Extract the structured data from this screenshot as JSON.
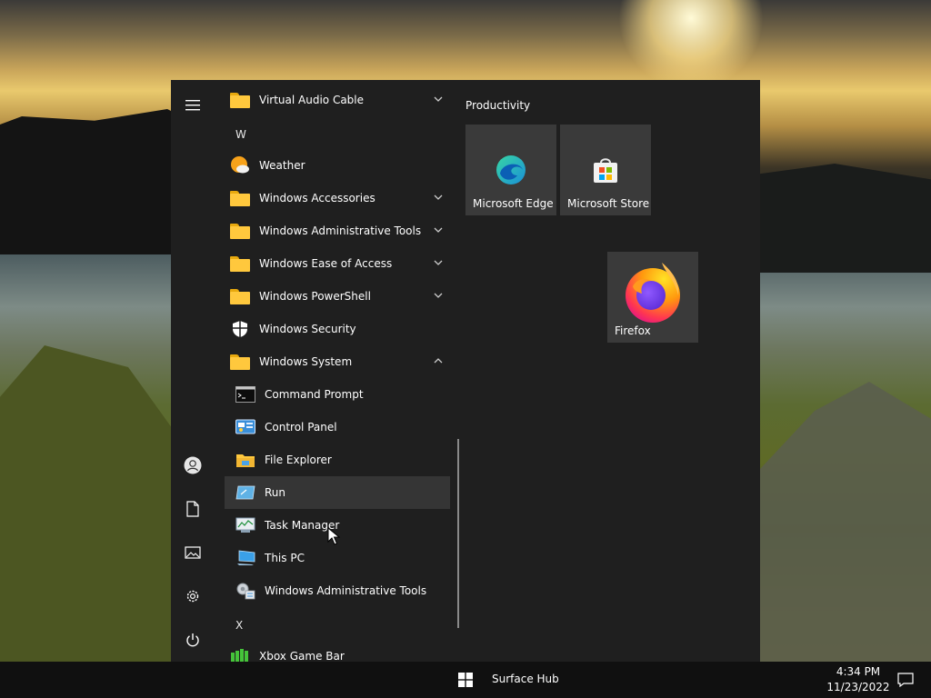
{
  "apps": {
    "virtual_audio_cable": "Virtual Audio Cable",
    "letter_w": "W",
    "weather": "Weather",
    "windows_accessories": "Windows Accessories",
    "windows_admin_tools": "Windows Administrative Tools",
    "windows_ease_of_access": "Windows Ease of Access",
    "windows_powershell": "Windows PowerShell",
    "windows_security": "Windows Security",
    "windows_system": "Windows System",
    "command_prompt": "Command Prompt",
    "control_panel": "Control Panel",
    "file_explorer": "File Explorer",
    "run": "Run",
    "task_manager": "Task Manager",
    "this_pc": "This PC",
    "windows_admin_tools_sub": "Windows Administrative Tools",
    "letter_x": "X",
    "xbox_game_bar": "Xbox Game Bar"
  },
  "tiles": {
    "group_title": "Productivity",
    "edge": "Microsoft Edge",
    "store": "Microsoft Store",
    "firefox": "Firefox"
  },
  "taskbar": {
    "app_label": "Surface Hub",
    "time": "4:34 PM",
    "date": "11/23/2022"
  },
  "colors": {
    "menu_bg": "#1f1f1f",
    "tile_bg": "#3a3a3a",
    "folder": "#ffc83d",
    "hover": "#353535"
  }
}
